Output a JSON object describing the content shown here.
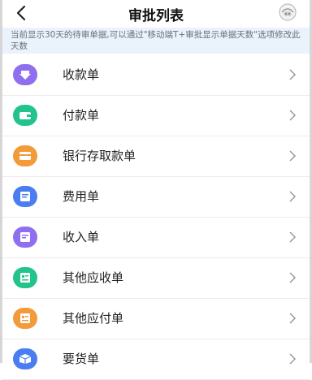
{
  "header": {
    "title": "审批列表"
  },
  "notice": {
    "text": "当前显示30天的待审单据,可以通过\"移动端T+审批显示单据天数\"选项修改此天数"
  },
  "items": [
    {
      "label": "收款单",
      "color": "#8f6ff0",
      "icon": "download-arrow-icon"
    },
    {
      "label": "付款单",
      "color": "#23c38c",
      "icon": "wallet-icon"
    },
    {
      "label": "银行存取款单",
      "color": "#f39a3a",
      "icon": "bank-card-icon"
    },
    {
      "label": "费用单",
      "color": "#4a7ef0",
      "icon": "expense-doc-icon"
    },
    {
      "label": "收入单",
      "color": "#8f6ff0",
      "icon": "income-doc-icon"
    },
    {
      "label": "其他应收单",
      "color": "#23c38c",
      "icon": "receivable-doc-icon"
    },
    {
      "label": "其他应付单",
      "color": "#f39a3a",
      "icon": "payable-doc-icon"
    },
    {
      "label": "要货单",
      "color": "#4a7ef0",
      "icon": "request-box-icon"
    }
  ]
}
